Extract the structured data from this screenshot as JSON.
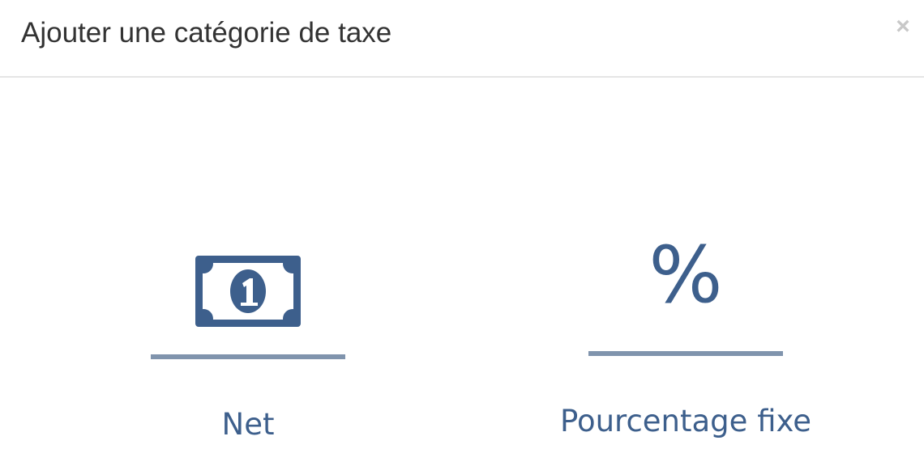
{
  "modal": {
    "title": "Ajouter une catégorie de taxe",
    "close_label": "×"
  },
  "options": [
    {
      "label": "Net",
      "icon": "money-bill-icon"
    },
    {
      "label": "Pourcentage fixe",
      "icon": "percent-icon",
      "glyph": "%"
    }
  ],
  "colors": {
    "accent": "#3d5f8c",
    "underline": "#8094ad",
    "title": "#333333",
    "close": "#c8c8c8",
    "divider": "#e5e5e5"
  }
}
